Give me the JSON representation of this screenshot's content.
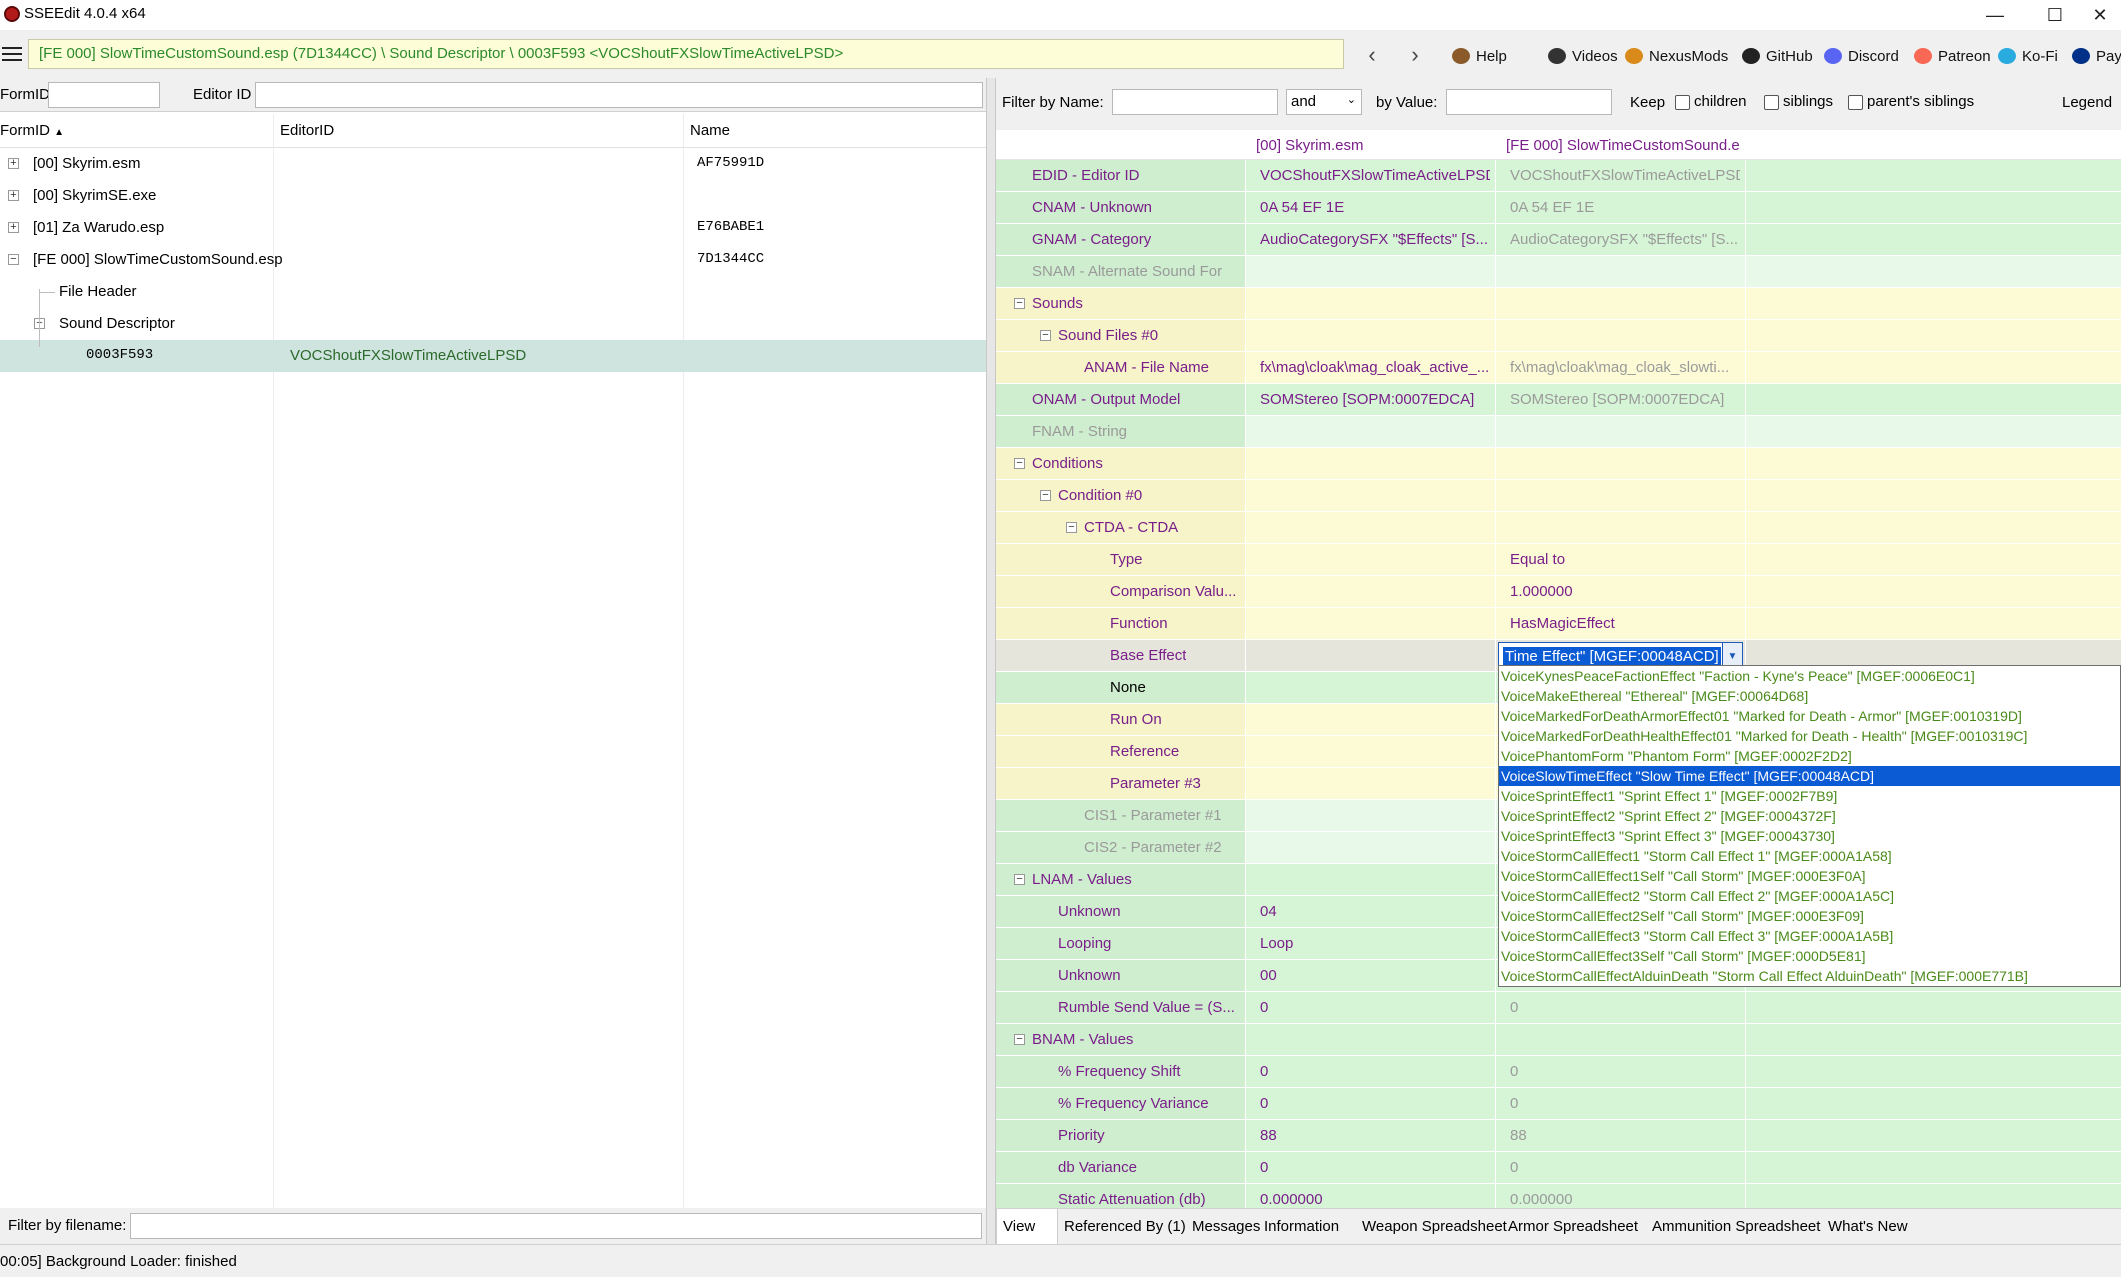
{
  "window": {
    "title": "SSEEdit 4.0.4 x64",
    "minimize": "—",
    "maximize": "☐",
    "close": "✕"
  },
  "toolbar": {
    "path": "[FE 000] SlowTimeCustomSound.esp (7D1344CC) \\ Sound Descriptor \\ 0003F593 <VOCShoutFXSlowTimeActiveLPSD>",
    "back": "‹",
    "forward": "›",
    "links": [
      {
        "label": "Help",
        "icon": "book-icon",
        "color": "#8a5a2b"
      },
      {
        "label": "Videos",
        "icon": "film-icon",
        "color": "#333333"
      },
      {
        "label": "NexusMods",
        "icon": "nexus-icon",
        "color": "#d98a1a"
      },
      {
        "label": "GitHub",
        "icon": "github-icon",
        "color": "#222222"
      },
      {
        "label": "Discord",
        "icon": "discord-icon",
        "color": "#5865f2"
      },
      {
        "label": "Patreon",
        "icon": "patreon-icon",
        "color": "#f96854"
      },
      {
        "label": "Ko-Fi",
        "icon": "kofi-icon",
        "color": "#29abe0"
      },
      {
        "label": "PayPa",
        "icon": "paypal-icon",
        "color": "#003087"
      }
    ]
  },
  "left": {
    "filter_formid_label": "FormID",
    "filter_editorid_label": "Editor ID",
    "col_formid": "FormID",
    "col_editorid": "EditorID",
    "col_name": "Name",
    "rows": [
      {
        "label": "[00] Skyrim.esm",
        "name": "AF75991D",
        "indent": 0,
        "exp": "+"
      },
      {
        "label": "[00] SkyrimSE.exe",
        "name": "",
        "indent": 0,
        "exp": "+"
      },
      {
        "label": "[01] Za Warudo.esp",
        "name": "E76BABE1",
        "indent": 0,
        "exp": "+"
      },
      {
        "label": "[FE 000] SlowTimeCustomSound.esp",
        "name": "7D1344CC",
        "indent": 0,
        "exp": "−"
      },
      {
        "label": "File Header",
        "name": "",
        "indent": 1,
        "exp": ""
      },
      {
        "label": "Sound Descriptor",
        "name": "",
        "indent": 1,
        "exp": "−"
      }
    ],
    "selected": {
      "formid": "0003F593",
      "editorid": "VOCShoutFXSlowTimeActiveLPSD"
    },
    "filter_filename_label": "Filter by filename:"
  },
  "right": {
    "filter_name_label": "Filter by Name:",
    "and_value": "and",
    "filter_value_label": "by Value:",
    "keep_label": "Keep",
    "children_label": "children",
    "siblings_label": "siblings",
    "parents_label": "parent's siblings",
    "legend_label": "Legend",
    "header_col1": "[00] Skyrim.esm",
    "header_col2": "[FE 000] SlowTimeCustomSound.e...",
    "rows": [
      {
        "label": "EDID - Editor ID",
        "v1": "VOCShoutFXSlowTimeActiveLPSD",
        "v2": "VOCShoutFXSlowTimeActiveLPSD",
        "style": "green",
        "depth": 0
      },
      {
        "label": "CNAM - Unknown",
        "v1": "0A 54 EF 1E",
        "v2": "0A 54 EF 1E",
        "style": "green",
        "depth": 0
      },
      {
        "label": "GNAM - Category",
        "v1": "AudioCategorySFX \"$Effects\" [S...",
        "v2": "AudioCategorySFX \"$Effects\" [S...",
        "style": "green",
        "depth": 0
      },
      {
        "label": "SNAM - Alternate Sound For",
        "v1": "",
        "v2": "",
        "style": "lightgreen",
        "depth": 0,
        "dim": true
      },
      {
        "label": "Sounds",
        "v1": "",
        "v2": "",
        "style": "yellow",
        "depth": 0,
        "exp": "−"
      },
      {
        "label": "Sound Files #0",
        "v1": "",
        "v2": "",
        "style": "yellow",
        "depth": 1,
        "exp": "−"
      },
      {
        "label": "ANAM - File Name",
        "v1": "fx\\mag\\cloak\\mag_cloak_active_...",
        "v2": "fx\\mag\\cloak\\mag_cloak_slowti...",
        "style": "yellow",
        "depth": 2
      },
      {
        "label": "ONAM - Output Model",
        "v1": "SOMStereo [SOPM:0007EDCA]",
        "v2": "SOMStereo [SOPM:0007EDCA]",
        "style": "green",
        "depth": 0
      },
      {
        "label": "FNAM - String",
        "v1": "",
        "v2": "",
        "style": "lightgreen",
        "depth": 0,
        "dim": true
      },
      {
        "label": "Conditions",
        "v1": "",
        "v2": "",
        "style": "yellow",
        "depth": 0,
        "exp": "−"
      },
      {
        "label": "Condition #0",
        "v1": "",
        "v2": "",
        "style": "yellow",
        "depth": 1,
        "exp": "−"
      },
      {
        "label": "CTDA - CTDA",
        "v1": "",
        "v2": "",
        "style": "yellow",
        "depth": 2,
        "exp": "−"
      },
      {
        "label": "Type",
        "v1": "",
        "v2": "Equal to",
        "style": "yellow",
        "depth": 3
      },
      {
        "label": "Comparison Valu...",
        "v1": "",
        "v2": "1.000000",
        "style": "yellow",
        "depth": 3
      },
      {
        "label": "Function",
        "v1": "",
        "v2": "HasMagicEffect",
        "style": "yellow",
        "depth": 3
      },
      {
        "label": "Base Effect",
        "v1": "",
        "v2": "",
        "style": "gray",
        "depth": 3
      },
      {
        "label": "None",
        "v1": "",
        "v2": "",
        "style": "green",
        "depth": 3,
        "black": true
      },
      {
        "label": "Run On",
        "v1": "",
        "v2": "",
        "style": "yellow",
        "depth": 3
      },
      {
        "label": "Reference",
        "v1": "",
        "v2": "",
        "style": "yellow",
        "depth": 3
      },
      {
        "label": "Parameter #3",
        "v1": "",
        "v2": "",
        "style": "yellow",
        "depth": 3
      },
      {
        "label": "CIS1 - Parameter #1",
        "v1": "",
        "v2": "",
        "style": "lightgreen",
        "depth": 2,
        "dim": true
      },
      {
        "label": "CIS2 - Parameter #2",
        "v1": "",
        "v2": "",
        "style": "lightgreen",
        "depth": 2,
        "dim": true
      },
      {
        "label": "LNAM - Values",
        "v1": "",
        "v2": "",
        "style": "green",
        "depth": 0,
        "exp": "−"
      },
      {
        "label": "Unknown",
        "v1": "04",
        "v2": "",
        "style": "green",
        "depth": 1
      },
      {
        "label": "Looping",
        "v1": "Loop",
        "v2": "",
        "style": "green",
        "depth": 1
      },
      {
        "label": "Unknown",
        "v1": "00",
        "v2": "",
        "style": "green",
        "depth": 1
      },
      {
        "label": "Rumble Send Value = (S...",
        "v1": "0",
        "v2": "0",
        "style": "green",
        "depth": 1
      },
      {
        "label": "BNAM - Values",
        "v1": "",
        "v2": "",
        "style": "green",
        "depth": 0,
        "exp": "−"
      },
      {
        "label": "% Frequency Shift",
        "v1": "0",
        "v2": "0",
        "style": "green",
        "depth": 1
      },
      {
        "label": "% Frequency Variance",
        "v1": "0",
        "v2": "0",
        "style": "green",
        "depth": 1
      },
      {
        "label": "Priority",
        "v1": "88",
        "v2": "88",
        "style": "green",
        "depth": 1
      },
      {
        "label": "db Variance",
        "v1": "0",
        "v2": "0",
        "style": "green",
        "depth": 1
      },
      {
        "label": "Static Attenuation (db)",
        "v1": "0.000000",
        "v2": "0.000000",
        "style": "green",
        "depth": 1
      }
    ],
    "dropdown_value": "Time Effect\" [MGEF:00048ACD]",
    "dropdown_items": [
      "VoiceKynesPeaceFactionEffect \"Faction - Kyne's Peace\" [MGEF:0006E0C1]",
      "VoiceMakeEthereal \"Ethereal\" [MGEF:00064D68]",
      "VoiceMarkedForDeathArmorEffect01 \"Marked for Death - Armor\" [MGEF:0010319D]",
      "VoiceMarkedForDeathHealthEffect01 \"Marked for Death - Health\" [MGEF:0010319C]",
      "VoicePhantomForm \"Phantom Form\" [MGEF:0002F2D2]",
      "VoiceSlowTimeEffect \"Slow Time Effect\" [MGEF:00048ACD]",
      "VoiceSprintEffect1 \"Sprint Effect 1\" [MGEF:0002F7B9]",
      "VoiceSprintEffect2 \"Sprint Effect 2\" [MGEF:0004372F]",
      "VoiceSprintEffect3 \"Sprint Effect 3\" [MGEF:00043730]",
      "VoiceStormCallEffect1 \"Storm Call Effect 1\" [MGEF:000A1A58]",
      "VoiceStormCallEffect1Self \"Call Storm\" [MGEF:000E3F0A]",
      "VoiceStormCallEffect2 \"Storm Call Effect 2\" [MGEF:000A1A5C]",
      "VoiceStormCallEffect2Self \"Call Storm\" [MGEF:000E3F09]",
      "VoiceStormCallEffect3 \"Storm Call Effect 3\" [MGEF:000A1A5B]",
      "VoiceStormCallEffect3Self \"Call Storm\" [MGEF:000D5E81]",
      "VoiceStormCallEffectAlduinDeath \"Storm Call Effect AlduinDeath\" [MGEF:000E771B]"
    ],
    "dropdown_selected_index": 5,
    "tabs": [
      "View",
      "Referenced By (1)",
      "Messages",
      "Information",
      "Weapon Spreadsheet",
      "Armor Spreadsheet",
      "Ammunition Spreadsheet",
      "What's New"
    ]
  },
  "status": "00:05] Background Loader: finished"
}
